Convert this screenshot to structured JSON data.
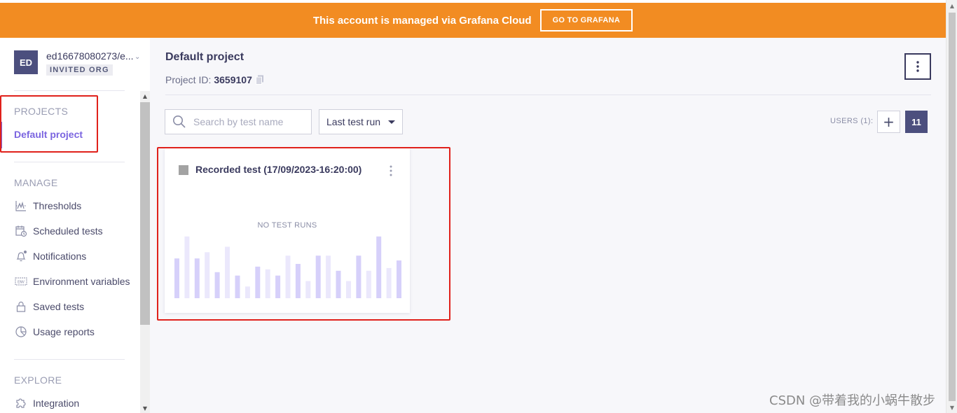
{
  "banner": {
    "text": "This account is managed via Grafana Cloud",
    "button_label": "GO TO GRAFANA",
    "color": "#f28c22"
  },
  "org": {
    "avatar_initials": "ED",
    "name": "ed16678080273/e...",
    "badge": "INVITED ORG"
  },
  "sidebar": {
    "projects_heading": "PROJECTS",
    "active_project": "Default project",
    "manage_heading": "MANAGE",
    "manage_items": [
      {
        "label": "Thresholds",
        "icon": "thresholds-icon"
      },
      {
        "label": "Scheduled tests",
        "icon": "calendar-clock-icon"
      },
      {
        "label": "Notifications",
        "icon": "bell-icon"
      },
      {
        "label": "Environment variables",
        "icon": "env-icon"
      },
      {
        "label": "Saved tests",
        "icon": "lock-icon"
      },
      {
        "label": "Usage reports",
        "icon": "pie-chart-icon"
      }
    ],
    "explore_heading": "EXPLORE",
    "explore_items": [
      {
        "label": "Integration",
        "icon": "puzzle-icon"
      }
    ],
    "accent": "#7b65e0"
  },
  "project": {
    "title": "Default project",
    "id_label": "Project ID:",
    "id_value": "3659107"
  },
  "toolbar": {
    "search_placeholder": "Search by test name",
    "sort_value": "Last test run",
    "users_label": "USERS (1):",
    "users_count": "11"
  },
  "test_card": {
    "title": "Recorded test (17/09/2023-16:20:00)",
    "empty_label": "NO TEST RUNS",
    "placeholder_bars": [
      0.58,
      0.9,
      0.58,
      0.67,
      0.38,
      0.75,
      0.33,
      0.17,
      0.46,
      0.42,
      0.33,
      0.62,
      0.5,
      0.25,
      0.62,
      0.62,
      0.4,
      0.25,
      0.62,
      0.4,
      0.9,
      0.44,
      0.55
    ]
  },
  "watermark": "CSDN @带着我的小蜗牛散步"
}
